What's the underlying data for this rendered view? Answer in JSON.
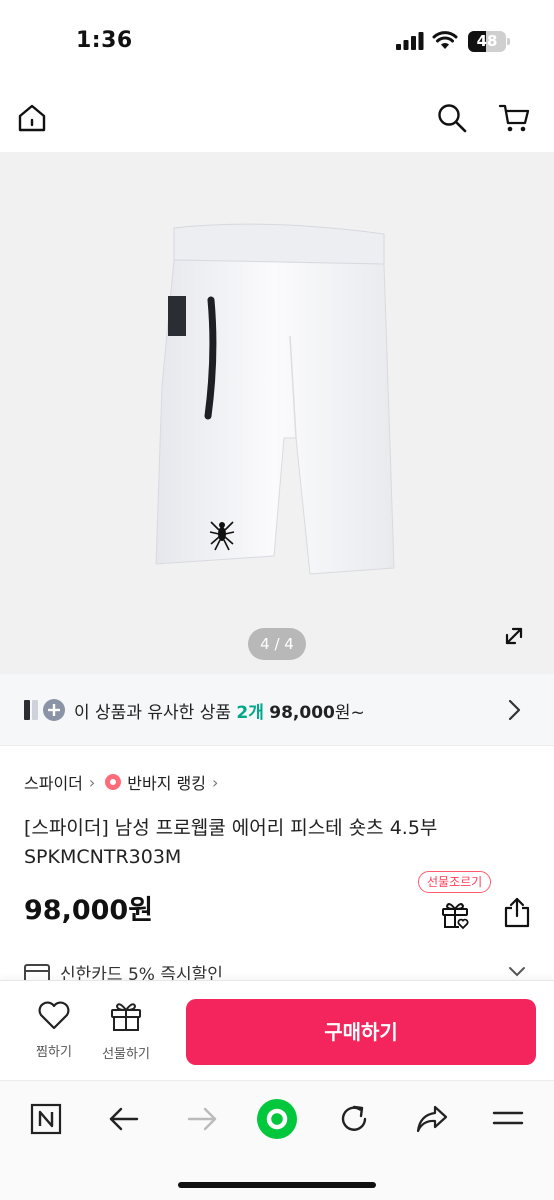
{
  "status_bar": {
    "time": "1:36",
    "battery": "48",
    "battery_level": 0.48
  },
  "product_image": {
    "pager": "4 / 4"
  },
  "similar": {
    "prefix": "이 상품과 유사한 상품",
    "count": "2개",
    "price": "98,000",
    "suffix": "원~"
  },
  "breadcrumb": {
    "brand": "스파이더",
    "ranking": "반바지 랭킹"
  },
  "product": {
    "title": "[스파이더] 남성 프로웹쿨 에어리 피스테 숏츠 4.5부 SPKMCNTR303M",
    "price": "98,000원",
    "gift_tag": "선물조르기"
  },
  "card_promo": {
    "text": "신한카드 5% 즉시할인"
  },
  "bottom_bar": {
    "like_label": "찜하기",
    "gift_label": "선물하기",
    "buy_label": "구매하기"
  },
  "colors": {
    "accent": "#f4245c",
    "highlight": "#00a88a",
    "browser_green": "#00c73c"
  },
  "icons": [
    "home-icon",
    "search-icon",
    "cart-icon",
    "expand-icon",
    "chevron-right-icon",
    "gift-icon",
    "share-icon",
    "heart-icon",
    "naver-n-icon",
    "back-arrow-icon",
    "forward-arrow-icon",
    "refresh-icon",
    "menu-icon"
  ]
}
